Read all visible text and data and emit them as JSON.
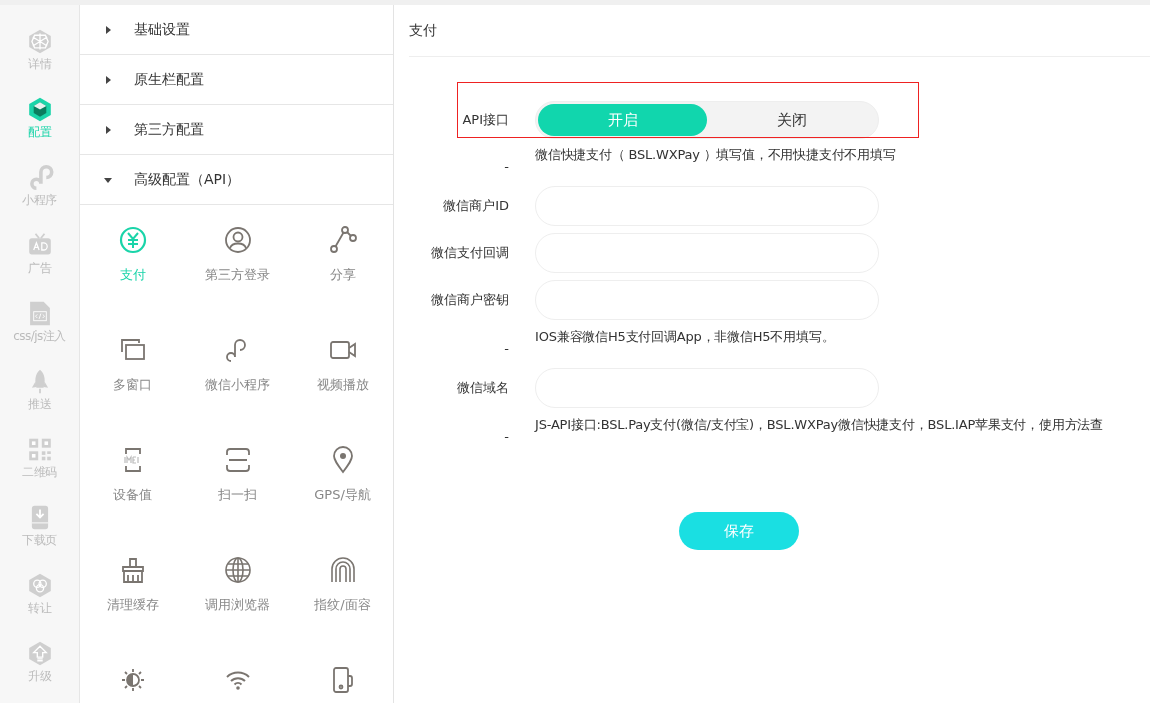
{
  "rail": [
    {
      "label": "详情",
      "selected": false
    },
    {
      "label": "配置",
      "selected": true
    },
    {
      "label": "小程序",
      "selected": false
    },
    {
      "label": "广告",
      "selected": false
    },
    {
      "label": "css/js注入",
      "selected": false
    },
    {
      "label": "推送",
      "selected": false
    },
    {
      "label": "二维码",
      "selected": false
    },
    {
      "label": "下载页",
      "selected": false
    },
    {
      "label": "转让",
      "selected": false
    },
    {
      "label": "升级",
      "selected": false
    }
  ],
  "menu": {
    "sections": [
      {
        "label": "基础设置",
        "expanded": false
      },
      {
        "label": "原生栏配置",
        "expanded": false
      },
      {
        "label": "第三方配置",
        "expanded": false
      },
      {
        "label": "高级配置（API）",
        "expanded": true
      }
    ],
    "items": [
      {
        "label": "支付",
        "selected": true
      },
      {
        "label": "第三方登录",
        "selected": false
      },
      {
        "label": "分享",
        "selected": false
      },
      {
        "label": "多窗口",
        "selected": false
      },
      {
        "label": "微信小程序",
        "selected": false
      },
      {
        "label": "视频播放",
        "selected": false
      },
      {
        "label": "设备值",
        "selected": false
      },
      {
        "label": "扫一扫",
        "selected": false
      },
      {
        "label": "GPS/导航",
        "selected": false
      },
      {
        "label": "清理缓存",
        "selected": false
      },
      {
        "label": "调用浏览器",
        "selected": false
      },
      {
        "label": "指纹/面容",
        "selected": false
      },
      {
        "selected": false
      },
      {
        "selected": false
      },
      {
        "selected": false
      }
    ]
  },
  "panel": {
    "title": "支付",
    "rows": [
      {
        "kind": "toggle",
        "label": "API接口",
        "options": [
          {
            "label": "开启",
            "selected": true
          },
          {
            "label": "关闭",
            "selected": false
          }
        ]
      },
      {
        "kind": "note",
        "label": "-",
        "text": "微信快捷支付（ BSL.WXPay ）填写值，不用快捷支付不用填写"
      },
      {
        "kind": "input",
        "label": "微信商户ID"
      },
      {
        "kind": "input",
        "label": "微信支付回调"
      },
      {
        "kind": "input",
        "label": "微信商户密钥"
      },
      {
        "kind": "note",
        "label": "-",
        "text": "IOS兼容微信H5支付回调App，非微信H5不用填写。"
      },
      {
        "kind": "input",
        "label": "微信域名"
      },
      {
        "kind": "note",
        "label": "-",
        "text": "JS-API接口:BSL.Pay支付(微信/支付宝)，BSL.WXPay微信快捷支付，BSL.IAP苹果支付，使用方法查"
      }
    ],
    "save": "保存"
  }
}
